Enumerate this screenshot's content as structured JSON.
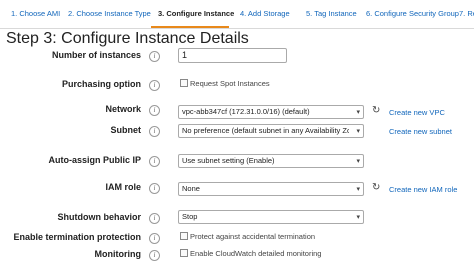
{
  "wizard": {
    "tabs": [
      {
        "label": "1. Choose AMI"
      },
      {
        "label": "2. Choose Instance Type"
      },
      {
        "label": "3. Configure Instance"
      },
      {
        "label": "4. Add Storage"
      },
      {
        "label": "5. Tag Instance"
      },
      {
        "label": "6. Configure Security Group"
      },
      {
        "label": "7. Re"
      }
    ],
    "active_tab": 2
  },
  "page": {
    "title": "Step 3: Configure Instance Details",
    "info_glyph": "i"
  },
  "form": {
    "number_of_instances": {
      "label": "Number of instances",
      "value": "1"
    },
    "purchasing_option": {
      "label": "Purchasing option",
      "checkbox_label": "Request Spot Instances",
      "checked": false
    },
    "network": {
      "label": "Network",
      "selected": "vpc-abb347cf (172.31.0.0/16) (default)",
      "link": "Create new VPC"
    },
    "subnet": {
      "label": "Subnet",
      "selected": "No preference (default subnet in any Availability Zon",
      "link": "Create new subnet"
    },
    "auto_assign_public_ip": {
      "label": "Auto-assign Public IP",
      "selected": "Use subnet setting (Enable)"
    },
    "iam_role": {
      "label": "IAM role",
      "selected": "None",
      "link": "Create new IAM role"
    },
    "shutdown_behavior": {
      "label": "Shutdown behavior",
      "selected": "Stop"
    },
    "termination_protection": {
      "label": "Enable termination protection",
      "checkbox_label": "Protect against accidental termination",
      "checked": false
    },
    "monitoring": {
      "label": "Monitoring",
      "checkbox_label": "Enable CloudWatch detailed monitoring",
      "checked": false
    }
  },
  "icons": {
    "chevron": "▾",
    "refresh": "↻"
  },
  "colors": {
    "link": "#1166bb",
    "active_tab_underline": "#e8891b"
  }
}
